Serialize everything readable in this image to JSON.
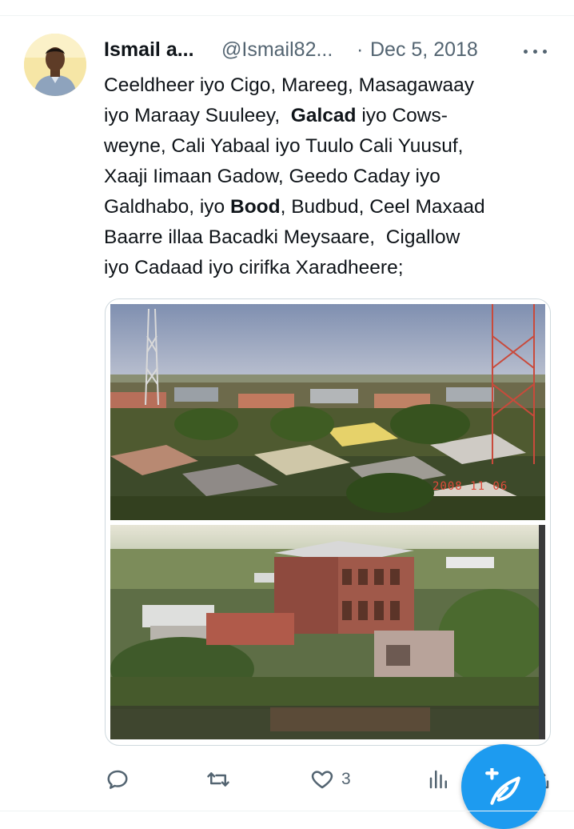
{
  "tweet": {
    "author_name": "Ismail a...",
    "handle": "@Ismail82...",
    "separator": "·",
    "date": "Dec 5, 2018",
    "lines": [
      "Ceeldheer iyo Cigo, Mareeg, Masagawaay",
      "iyo Maraay Suuleey,",
      "Galcad",
      "iyo Cows-",
      "weyne, Cali Yabaal iyo Tuulo Cali Yuusuf,",
      "Xaaji Iimaan Gadow, Geedo Caday iyo",
      "Galdhabo, iyo",
      "Bood",
      ", Budbud, Ceel Maxaad",
      "Baarre illaa Bacadki Meysaare,  Cigallow",
      "iyo Cadaad iyo cirifka Xaradheere;"
    ],
    "photo_stamp": "2008 11 06"
  },
  "actions": {
    "reply_icon": "reply-icon",
    "retweet_icon": "retweet-icon",
    "like_icon": "heart-icon",
    "like_count": "3",
    "views_icon": "views-bar-icon",
    "share_icon": "share-icon"
  },
  "fab": {
    "icon": "compose-feather-icon"
  },
  "colors": {
    "accent": "#1d9bf0",
    "muted": "#536471",
    "text": "#0f1419",
    "border": "#cfd9de"
  }
}
